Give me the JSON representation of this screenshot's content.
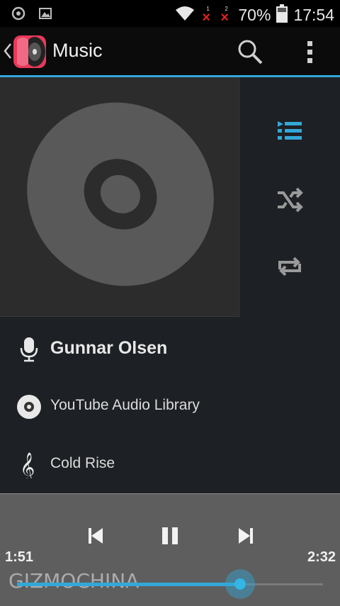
{
  "status_bar": {
    "battery_percent": "70%",
    "time": "17:54",
    "sim1_label": "1",
    "sim2_label": "2",
    "icons": [
      "record-icon",
      "image-icon",
      "wifi-icon",
      "sim-no-signal-icon",
      "battery-icon"
    ]
  },
  "action_bar": {
    "title": "Music",
    "icons": [
      "back-chevron-icon",
      "music-app-logo",
      "search-icon",
      "overflow-menu-icon"
    ],
    "accent_color": "#33a7d8"
  },
  "controls": {
    "playlist_icon": "playlist-icon",
    "shuffle_icon": "shuffle-icon",
    "repeat_icon": "repeat-icon"
  },
  "track": {
    "artist": "Gunnar Olsen",
    "album": "YouTube Audio Library",
    "title": "Cold Rise"
  },
  "player": {
    "elapsed": "1:51",
    "duration": "2:32",
    "progress_fraction": 0.73,
    "icons": [
      "previous-icon",
      "pause-icon",
      "next-icon"
    ]
  },
  "watermark": "GIZMOCHINA"
}
